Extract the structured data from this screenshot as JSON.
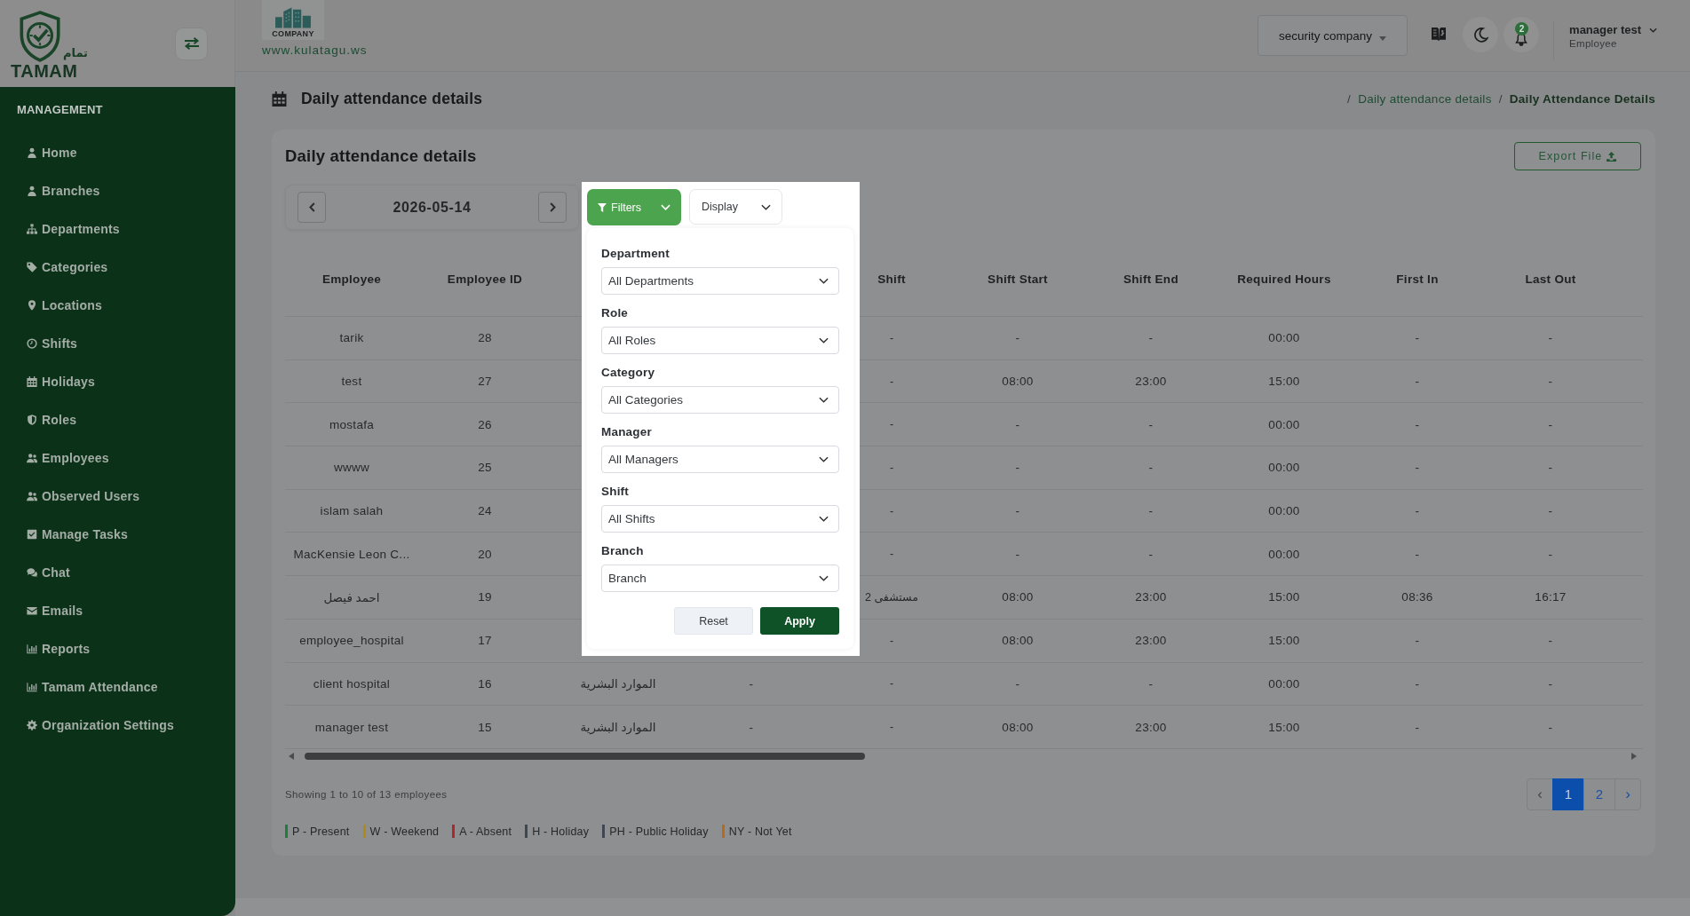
{
  "sidebar": {
    "logo": {
      "arabic": "تمام",
      "name": "TAMAM"
    },
    "section": "MANAGEMENT",
    "items": [
      {
        "label": "Home",
        "selected": false
      },
      {
        "label": "Branches",
        "selected": false
      },
      {
        "label": "Departments",
        "selected": false
      },
      {
        "label": "Categories",
        "selected": false
      },
      {
        "label": "Locations",
        "selected": false
      },
      {
        "label": "Shifts",
        "selected": false
      },
      {
        "label": "Holidays",
        "selected": false
      },
      {
        "label": "Roles",
        "selected": false
      },
      {
        "label": "Employees",
        "selected": false
      },
      {
        "label": "Observed Users",
        "selected": false
      },
      {
        "label": "Manage Tasks",
        "selected": false
      },
      {
        "label": "Chat",
        "selected": false
      },
      {
        "label": "Emails",
        "selected": false
      },
      {
        "label": "Reports",
        "selected": false
      },
      {
        "label": "Tamam Attendance",
        "selected": false
      },
      {
        "label": "Organization Settings",
        "selected": false
      }
    ]
  },
  "header": {
    "company_logo": {
      "caption": "COMPANY",
      "website": "www.kulatagu.ws"
    },
    "company_select": {
      "value": "security company"
    },
    "notifications": {
      "count": "2"
    },
    "user": {
      "name": "manager test",
      "role": "Employee"
    }
  },
  "page": {
    "title": "Daily attendance details",
    "breadcrumb": [
      {
        "separator": "/",
        "label": "Daily attendance details",
        "current": false
      },
      {
        "separator": "/",
        "label": "Daily Attendance Details",
        "current": true
      }
    ]
  },
  "card": {
    "title": "Daily attendance details",
    "export_button": "Export File",
    "date": "2026-05-14",
    "filter_menu": {
      "filters_button": "Filters",
      "display_button": "Display",
      "fields": [
        {
          "label": "Department",
          "value": "All Departments"
        },
        {
          "label": "Role",
          "value": "All Roles"
        },
        {
          "label": "Category",
          "value": "All Categories"
        },
        {
          "label": "Manager",
          "value": "All Managers"
        },
        {
          "label": "Shift",
          "value": "All Shifts"
        },
        {
          "label": "Branch",
          "value": "Branch"
        }
      ],
      "reset_button": "Reset",
      "apply_button": "Apply"
    },
    "table": {
      "columns": [
        "Employee",
        "Employee ID",
        null,
        null,
        "Shift",
        "Shift Start",
        "Shift End",
        "Required Hours",
        "First In",
        "Last Out"
      ],
      "rows": [
        [
          "tarik",
          "28",
          null,
          null,
          "-",
          "-",
          "-",
          "00:00",
          "-",
          "-"
        ],
        [
          "test",
          "27",
          null,
          null,
          "-",
          "08:00",
          "23:00",
          "15:00",
          "-",
          "-"
        ],
        [
          "mostafa",
          "26",
          null,
          null,
          "-",
          "-",
          "-",
          "00:00",
          "-",
          "-"
        ],
        [
          "wwww",
          "25",
          null,
          null,
          "-",
          "-",
          "-",
          "00:00",
          "-",
          "-"
        ],
        [
          "islam salah",
          "24",
          null,
          null,
          "-",
          "-",
          "-",
          "00:00",
          "-",
          "-"
        ],
        [
          "MacKensie Leon C...",
          "20",
          null,
          null,
          "-",
          "-",
          "-",
          "00:00",
          "-",
          "-"
        ],
        [
          "احمد فيصل",
          "19",
          null,
          null,
          "مستشفى 2",
          "08:00",
          "23:00",
          "15:00",
          "08:36",
          "16:17"
        ],
        [
          "employee_hospital",
          "17",
          null,
          null,
          "-",
          "08:00",
          "23:00",
          "15:00",
          "-",
          "-"
        ],
        [
          "client hospital",
          "16",
          "الموارد البشرية",
          "-",
          "-",
          "-",
          "-",
          "00:00",
          "-",
          "-"
        ],
        [
          "manager test",
          "15",
          "الموارد البشرية",
          "-",
          "-",
          "08:00",
          "23:00",
          "15:00",
          "-",
          "-"
        ]
      ]
    },
    "summary": "Showing 1 to 10 of 13 employees",
    "pagination": {
      "prev": {
        "label": "‹",
        "disabled": true
      },
      "pages": [
        {
          "label": "1",
          "selected": true
        },
        {
          "label": "2",
          "selected": false
        }
      ],
      "next": {
        "label": "›",
        "disabled": false
      }
    },
    "legend": [
      {
        "label": "P - Present",
        "color": "#1e7d3a"
      },
      {
        "label": "W - Weekend",
        "color": "#b08a12"
      },
      {
        "label": "A - Absent",
        "color": "#b0262f"
      },
      {
        "label": "H - Holiday",
        "color": "#3f4852"
      },
      {
        "label": "PH - Public Holiday",
        "color": "#3f4852"
      },
      {
        "label": "NY - Not Yet",
        "color": "#b86a1c"
      }
    ]
  }
}
